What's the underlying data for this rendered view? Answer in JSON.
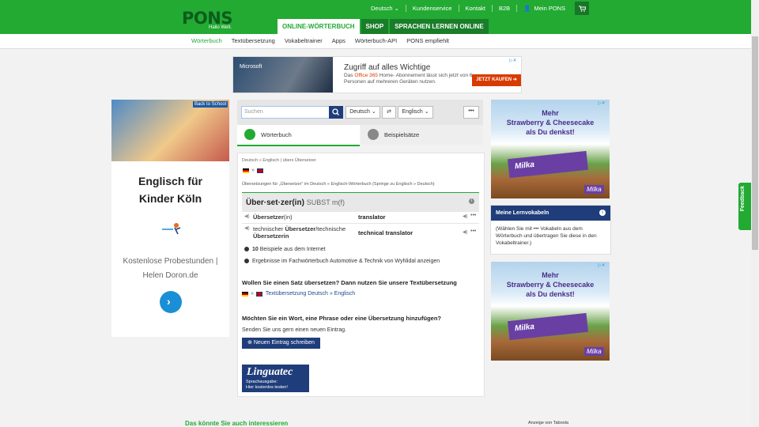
{
  "header": {
    "logo": "PONS",
    "tagline": "Hallo Welt.",
    "tabs": [
      {
        "label": "ONLINE-WÖRTERBUCH",
        "active": true
      },
      {
        "label": "SHOP",
        "active": false
      },
      {
        "label": "SPRACHEN LERNEN ONLINE",
        "active": false
      }
    ],
    "top_links": {
      "language": "Deutsch",
      "service": "Kundenservice",
      "contact": "Kontakt",
      "b2b": "B2B",
      "account": "Mein PONS"
    },
    "accent": "#22aa33"
  },
  "subnav": [
    "Wörterbuch",
    "Textübersetzung",
    "Vokabeltrainer",
    "Apps",
    "Wörterbuch-API",
    "PONS empfiehlt"
  ],
  "ad_top": {
    "brand": "Microsoft",
    "title": "Zugriff auf alles Wichtige",
    "desc_pre": "Das ",
    "desc_highlight": "Office 365",
    "desc_post": " Home- Abonnement lässt sich jetzt von 6 Personen auf mehreren Geräten nutzen.",
    "cta": "JETZT KAUFEN"
  },
  "left_ad": {
    "corner": "Back to School",
    "headline_1": "Englisch für",
    "headline_2": "Kinder Köln",
    "brand": "Helen Doron",
    "sub_1": "Kostenlose Probestunden |",
    "sub_2": "Helen Doron.de"
  },
  "search": {
    "placeholder": "Suchen",
    "from_lang": "Deutsch",
    "to_lang": "Englisch",
    "more": "•••"
  },
  "mode_tabs": {
    "dictionary": "Wörterbuch",
    "examples": "Beispielsätze"
  },
  "result": {
    "breadcrumb": "Deutsch » Englisch | übers Übersetzer",
    "infoline": "Übersetzungen für „Übersetzer“ im Deutsch » Englisch-Wörterbuch (Springe zu Englisch » Deutsch)",
    "headword": "Über·set·zer(in)",
    "gram": "SUBST m(f)",
    "rows": [
      {
        "src_bold": "Übersetzer",
        "src_rest": "(in)",
        "tgt": "translator"
      },
      {
        "src_pre": "technischer ",
        "src_bold": "Übersetzer",
        "src_mid": "/technische ",
        "src_bold2": "Übersetzerin",
        "tgt": "technical translator"
      }
    ],
    "examples_count": "10",
    "examples_label": " Beispiele aus dem Internet",
    "specialist": "Ergebnisse im Fachwörterbuch Automotive & Technik von Wyhlidal anzeigen",
    "q1": "Wollen Sie einen Satz übersetzen? Dann nutzen Sie unsere Textübersetzung",
    "q1_link": "Textübersetzung Deutsch » Englisch",
    "q2": "Möchten Sie ein Wort, eine Phrase oder eine Übersetzung hinzufügen?",
    "send": "Senden Sie uns gern einen neuen Eintrag.",
    "new_entry": "Neuen Eintrag schreiben",
    "linguatec_1": "Linguatec",
    "linguatec_2": "Sprachausgabe:",
    "linguatec_3": "Hier kostenlos testen!"
  },
  "milka_ad": {
    "line1": "Mehr",
    "line2": "Strawberry & Cheesecake",
    "line3": "als Du denkst!",
    "bar": "Milka",
    "logo": "Milka"
  },
  "lernvokabeln": {
    "title": "Meine Lernvokabeln",
    "body": "(Wählen Sie mit ••• Vokabeln aus dem Wörterbuch und übertragen Sie diese in den Vokabeltrainer.)"
  },
  "feedback": "Feedback",
  "footer": {
    "title": "Das könnte Sie auch interessieren",
    "taboola": "Anzeige von Taboola"
  }
}
